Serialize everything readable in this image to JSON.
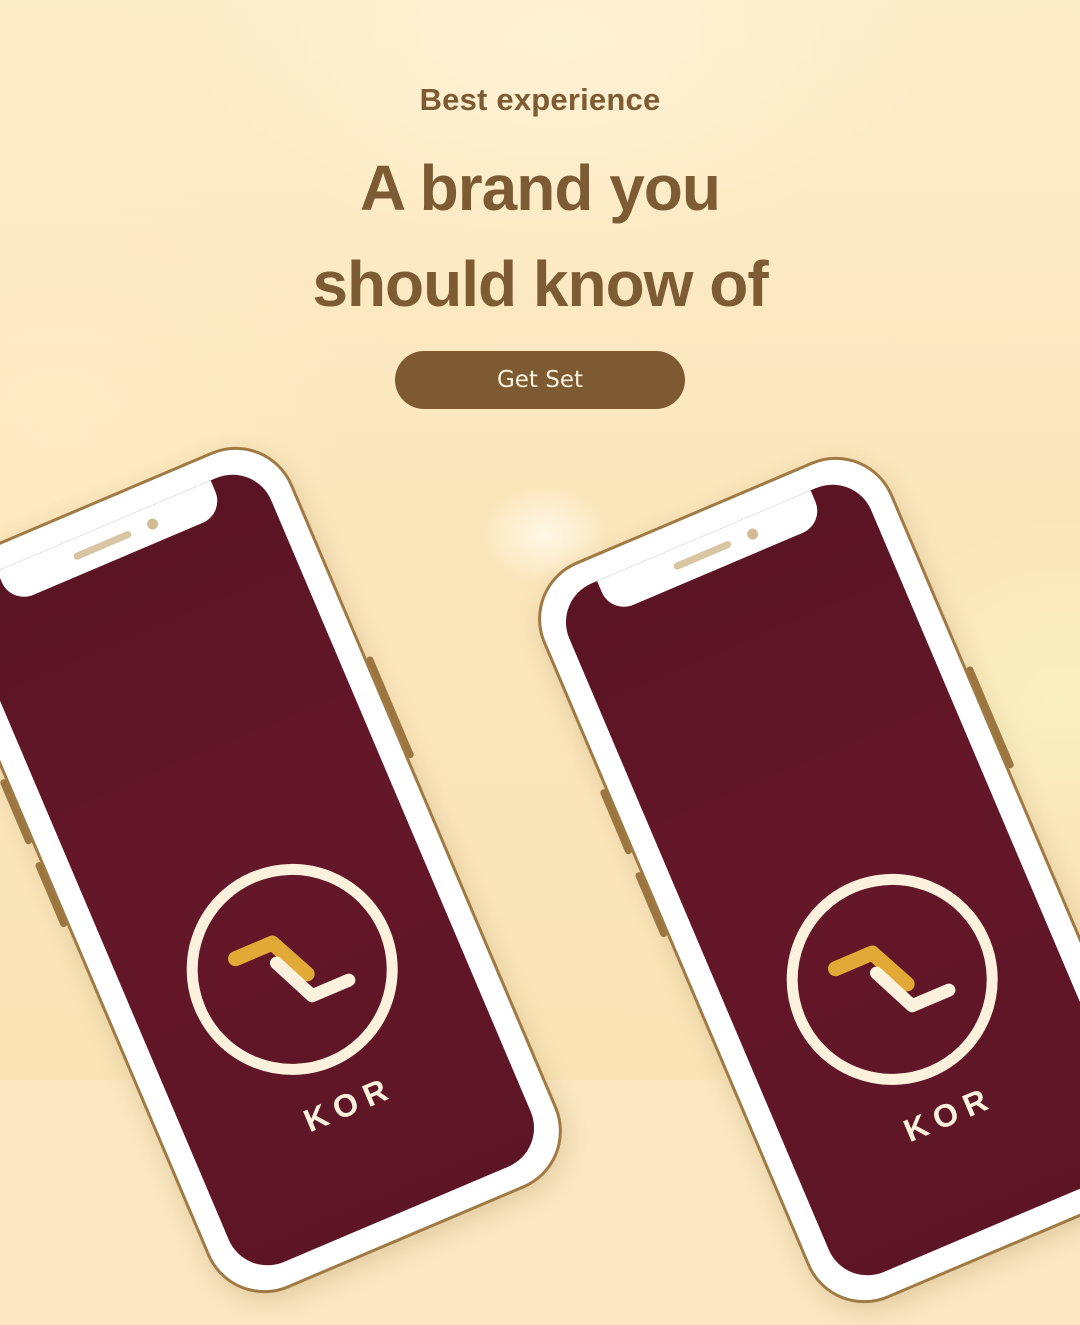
{
  "hero": {
    "eyebrow": "Best experience",
    "headline_line1": "A brand you",
    "headline_line2": "should know of",
    "cta_label": "Get Set"
  },
  "phones": [
    {
      "brand_text": "KOR"
    },
    {
      "brand_text": "KOR"
    }
  ],
  "colors": {
    "background": "#fbe8c0",
    "text_brown": "#7d5c35",
    "button_brown": "#7e5a33",
    "screen_maroon": "#5e1526",
    "logo_gold": "#e2a936",
    "logo_cream": "#fbf1dd"
  }
}
